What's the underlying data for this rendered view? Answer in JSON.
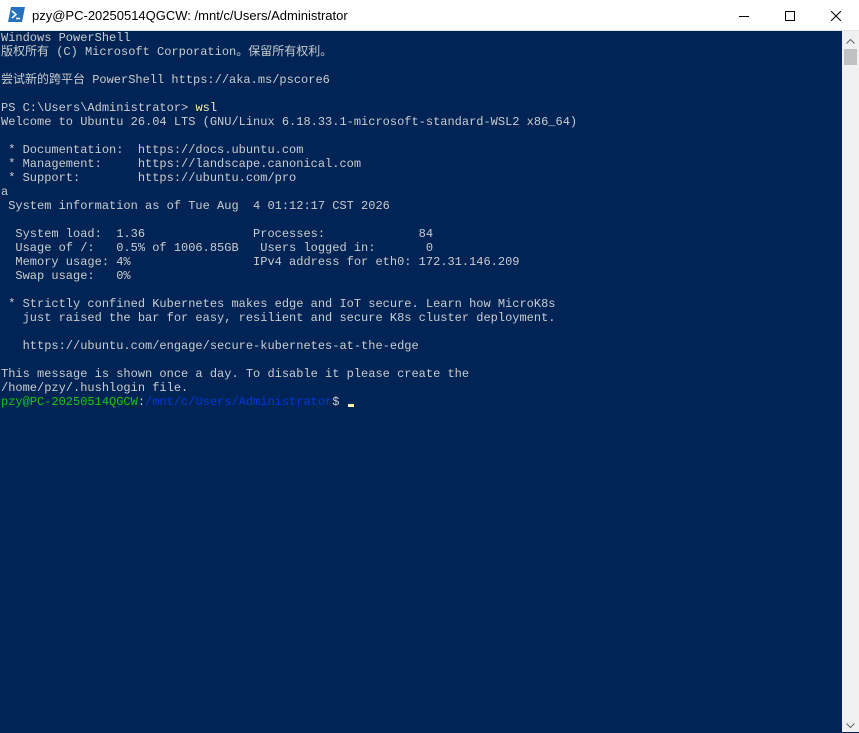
{
  "window": {
    "title": "pzy@PC-20250514QGCW: /mnt/c/Users/Administrator",
    "icon": "powershell-icon",
    "controls": [
      "minimize-icon",
      "maximize-icon",
      "close-icon"
    ]
  },
  "colors": {
    "background": "#012456",
    "text": "#cccccc",
    "command": "#f9f1a5",
    "prompt_user": "#16c60c",
    "prompt_path": "#0037da"
  },
  "terminal": {
    "lines": [
      "Windows PowerShell",
      "版权所有 (C) Microsoft Corporation。保留所有权利。",
      "",
      "尝试新的跨平台 PowerShell https://aka.ms/pscore6",
      "",
      "PS C:\\Users\\Administrator> ",
      "Welcome to Ubuntu 26.04 LTS (GNU/Linux 6.18.33.1-microsoft-standard-WSL2 x86_64)",
      "",
      " * Documentation:  https://docs.ubuntu.com",
      " * Management:     https://landscape.canonical.com",
      " * Support:        https://ubuntu.com/pro",
      "a",
      " System information as of Tue Aug  4 01:12:17 CST 2026",
      "",
      "  System load:  1.36               Processes:             84",
      "  Usage of /:   0.5% of 1006.85GB   Users logged in:       0",
      "  Memory usage: 4%                 IPv4 address for eth0: 172.31.146.209",
      "  Swap usage:   0%",
      "",
      " * Strictly confined Kubernetes makes edge and IoT secure. Learn how MicroK8s",
      "   just raised the bar for easy, resilient and secure K8s cluster deployment.",
      "",
      "   https://ubuntu.com/engage/secure-kubernetes-at-the-edge",
      "",
      "This message is shown once a day. To disable it please create the",
      "/home/pzy/.hushlogin file."
    ],
    "ps_command": "wsl",
    "prompt_user": "pzy@PC-20250514QGCW",
    "prompt_colon": ":",
    "prompt_path": "/mnt/c/Users/Administrator",
    "prompt_symbol": "$ "
  }
}
